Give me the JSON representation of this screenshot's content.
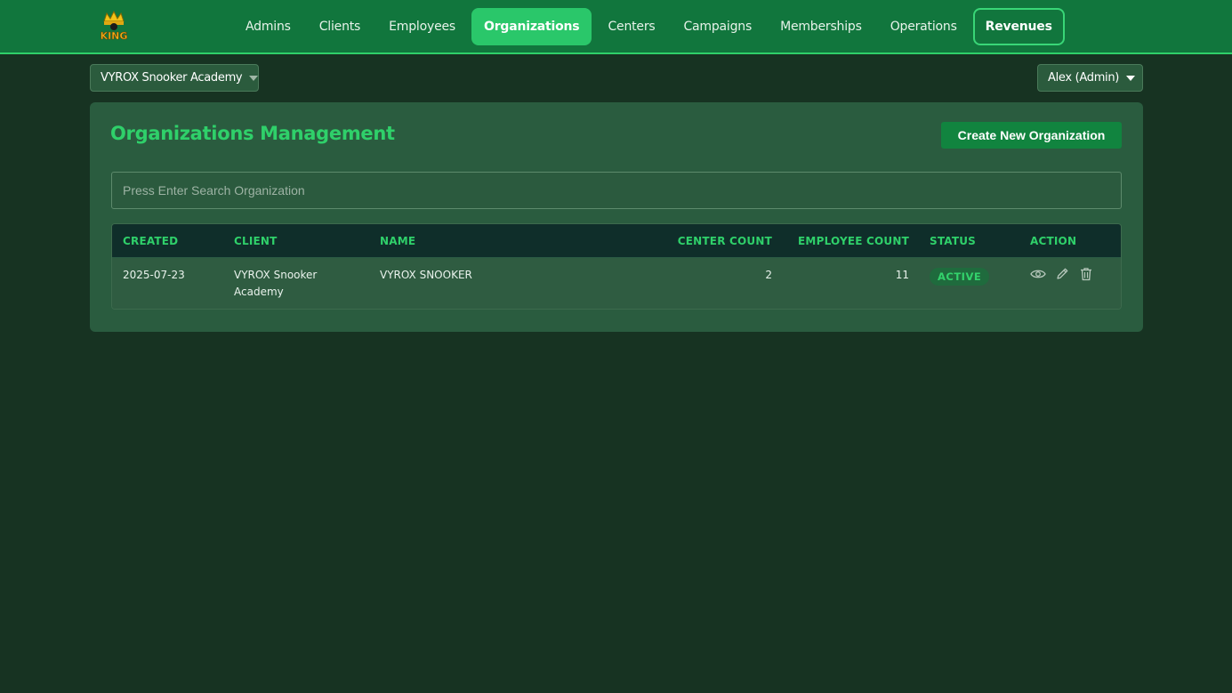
{
  "logo": {
    "text": "KING",
    "icon": "crown-logo"
  },
  "nav": {
    "items": [
      {
        "label": "Admins"
      },
      {
        "label": "Clients"
      },
      {
        "label": "Employees"
      },
      {
        "label": "Organizations"
      },
      {
        "label": "Centers"
      },
      {
        "label": "Campaigns"
      },
      {
        "label": "Memberships"
      },
      {
        "label": "Operations"
      },
      {
        "label": "Revenues"
      }
    ],
    "active": "Organizations"
  },
  "org_selector": {
    "value": "VYROX Snooker Academy"
  },
  "user_menu": {
    "value": "Alex (Admin)"
  },
  "main": {
    "title": "Organizations Management",
    "create_label": "Create New Organization",
    "search": {
      "placeholder": "Press Enter Search Organization",
      "value": ""
    },
    "table": {
      "columns": [
        "CREATED",
        "CLIENT",
        "NAME",
        "CENTER COUNT",
        "EMPLOYEE COUNT",
        "STATUS",
        "ACTION"
      ],
      "rows": [
        {
          "created": "2025-07-23",
          "client": "VYROX Snooker Academy",
          "name": "VYROX SNOOKER",
          "center_count": "2",
          "employee_count": "11",
          "status": "ACTIVE",
          "actions": [
            "eye-icon",
            "pencil-icon",
            "trash-icon"
          ]
        }
      ]
    }
  },
  "colors": {
    "background": "#173322",
    "topbar": "#11763d",
    "accent": "#2fd06a",
    "card": "#2a5c3f"
  }
}
